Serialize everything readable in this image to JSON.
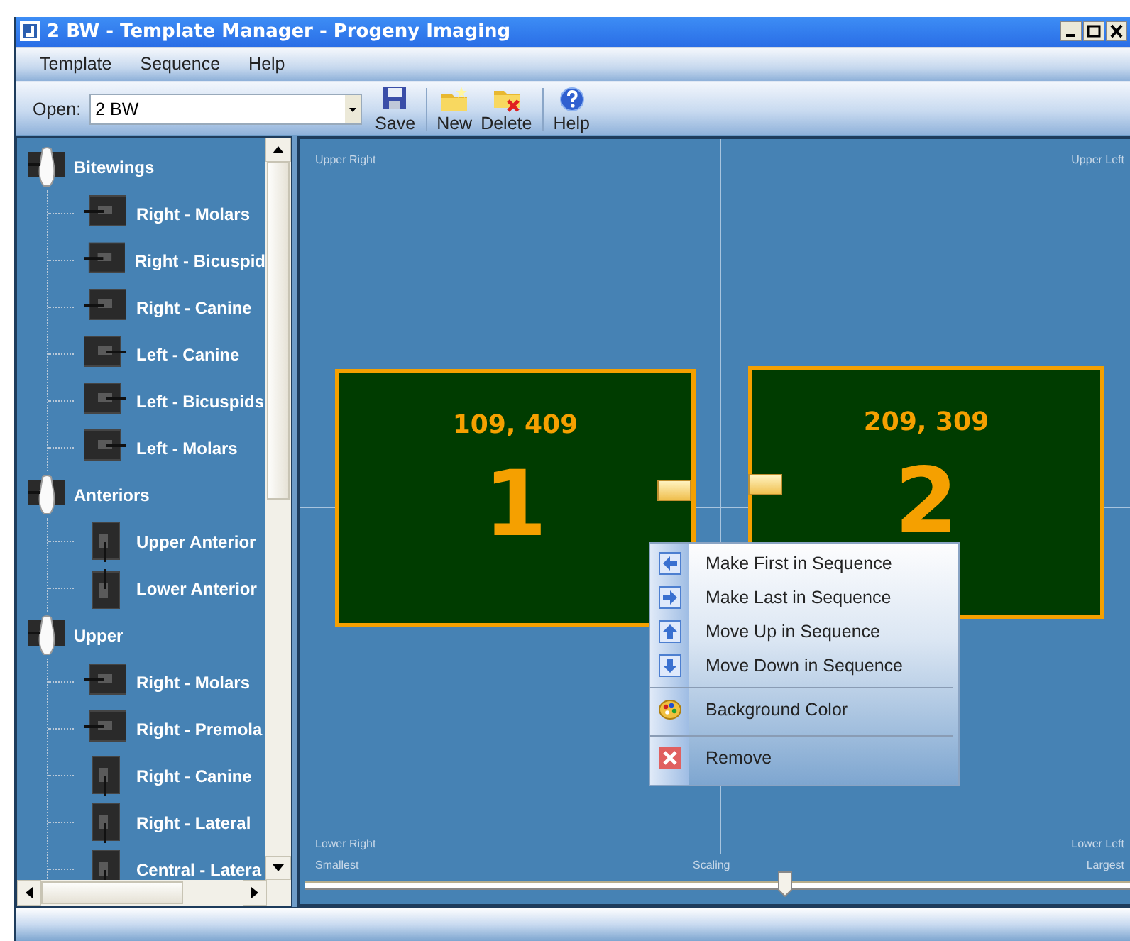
{
  "window": {
    "title": "2 BW - Template Manager - Progeny Imaging"
  },
  "menu": [
    "Template",
    "Sequence",
    "Help"
  ],
  "toolbar": {
    "open_label": "Open:",
    "open_value": "2 BW",
    "buttons": [
      {
        "label": "Save",
        "kind": "save"
      },
      {
        "label": "New",
        "kind": "new"
      },
      {
        "label": "Delete",
        "kind": "delete"
      },
      {
        "label": "Help",
        "kind": "help"
      }
    ]
  },
  "tree": [
    {
      "label": "Bitewings",
      "children": [
        {
          "label": "Right - Molars",
          "kind": "bar-left"
        },
        {
          "label": "Right - Bicuspid",
          "kind": "bar-left"
        },
        {
          "label": "Right - Canine",
          "kind": "bar-left"
        },
        {
          "label": "Left - Canine",
          "kind": "bar-right"
        },
        {
          "label": "Left - Bicuspids",
          "kind": "bar-right"
        },
        {
          "label": "Left - Molars",
          "kind": "bar-right"
        }
      ]
    },
    {
      "label": "Anteriors",
      "children": [
        {
          "label": "Upper Anterior",
          "kind": "bar-down"
        },
        {
          "label": "Lower Anterior",
          "kind": "bar-up"
        }
      ]
    },
    {
      "label": "Upper",
      "children": [
        {
          "label": "Right - Molars",
          "kind": "bar-left"
        },
        {
          "label": "Right - Premola",
          "kind": "bar-left"
        },
        {
          "label": "Right - Canine",
          "kind": "bar-down"
        },
        {
          "label": "Right - Lateral",
          "kind": "bar-down"
        },
        {
          "label": "Central - Latera",
          "kind": "bar-down"
        }
      ]
    }
  ],
  "canvas": {
    "upper_right": "Upper Right",
    "upper_left": "Upper Left",
    "lower_right": "Lower Right",
    "lower_left": "Lower Left",
    "images": [
      {
        "position": "109, 409",
        "number": "1"
      },
      {
        "position": "209, 309",
        "number": "2"
      }
    ],
    "scaling": {
      "min_label": "Smallest",
      "label": "Scaling",
      "max_label": "Largest",
      "level": 0.57
    }
  },
  "context_menu": [
    {
      "label": "Make First in Sequence",
      "kind": "first",
      "separator_before": false
    },
    {
      "label": "Make Last in Sequence",
      "kind": "last",
      "separator_before": false
    },
    {
      "label": "Move Up in Sequence",
      "kind": "up",
      "separator_before": false
    },
    {
      "label": "Move Down in Sequence",
      "kind": "down",
      "separator_before": false
    },
    {
      "label": "Background Color",
      "kind": "color",
      "separator_before": true
    },
    {
      "label": "Remove",
      "kind": "remove",
      "separator_before": true
    }
  ]
}
